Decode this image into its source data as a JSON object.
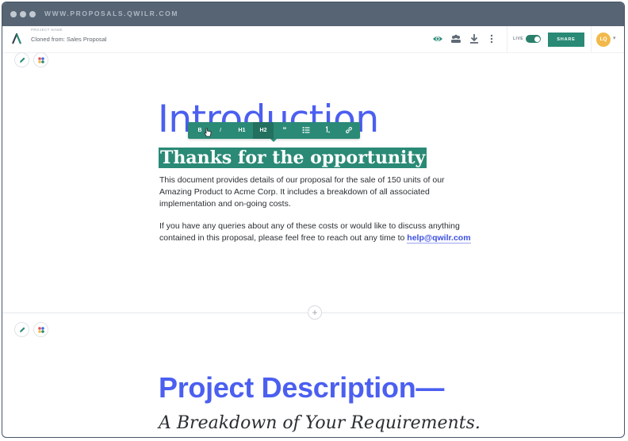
{
  "browser": {
    "url": "WWW.PROPOSALS.QWILR.COM"
  },
  "header": {
    "project_label": "PROJECT NAME",
    "project_name": "Cloned from: Sales Proposal",
    "live_label": "LIVE",
    "share_label": "SHARE",
    "avatar_initials": "LQ"
  },
  "editor_toolbar": {
    "bold": "B",
    "italic": "I",
    "h1": "H1",
    "h2": "H2",
    "quote": "“",
    "active": "H2"
  },
  "section1": {
    "title": "Introduction",
    "subtitle": "Thanks for the opportunity",
    "para1": "This document provides details of our proposal for the sale of 150 units of our Amazing Product to Acme Corp. It includes a breakdown of all associated implementation and on-going costs.",
    "para2_text": "If you have any queries about any of these costs or would like to discuss anything contained in this proposal, please feel free to reach out any time to ",
    "para2_link": "help@qwilr.com"
  },
  "section2": {
    "title": "Project Description—",
    "subtitle": "A Breakdown of Your Requirements."
  },
  "colors": {
    "chrome": "#566474",
    "accent": "#2a8a76",
    "heading_blue": "#4b5ff0",
    "avatar": "#f2b94a"
  },
  "icons": [
    "logo-icon",
    "eye-icon",
    "team-icon",
    "download-icon",
    "more-vertical-icon",
    "pencil-icon",
    "palette-icon",
    "bullet-list-icon",
    "numbered-list-icon",
    "link-icon",
    "plus-icon",
    "cursor-icon",
    "chevron-down-icon"
  ]
}
